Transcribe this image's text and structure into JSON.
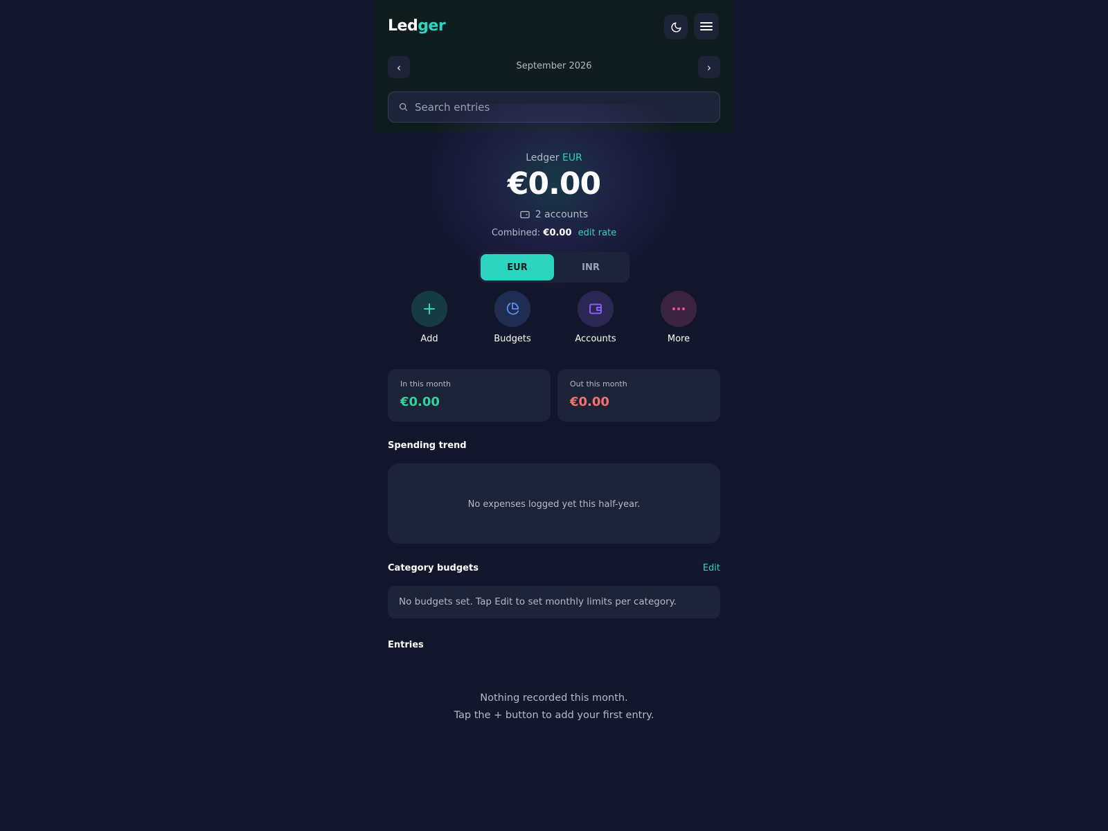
{
  "header": {
    "logo_part1": "Led",
    "logo_part2": "ger",
    "theme_icon": "moon-icon",
    "menu_icon": "hamburger-menu-icon"
  },
  "month_nav": {
    "prev": "‹",
    "label": "September 2026",
    "next": "›"
  },
  "search": {
    "placeholder": "Search entries",
    "value": "",
    "icon": "search-icon"
  },
  "hero": {
    "label": "Ledger",
    "currency": "EUR",
    "balance": "€0.00",
    "accounts_count": "2 accounts",
    "combined_label": "Combined:",
    "combined_value": "€0.00",
    "edit_rate": "edit rate"
  },
  "currency_toggle": {
    "options": [
      "EUR",
      "INR"
    ],
    "selected": "EUR"
  },
  "actions": [
    {
      "label": "Add",
      "icon": "plus-icon",
      "color": "#2dd4bf"
    },
    {
      "label": "Budgets",
      "icon": "pie-chart-icon",
      "color": "#5b8def"
    },
    {
      "label": "Accounts",
      "icon": "wallet-icon",
      "color": "#8b5cf6"
    },
    {
      "label": "More",
      "icon": "more-dots-icon",
      "color": "#ec4899"
    }
  ],
  "stats": {
    "in_label": "In this month",
    "in_value": "€0.00",
    "out_label": "Out this month",
    "out_value": "€0.00"
  },
  "spending_trend": {
    "title": "Spending trend",
    "empty": "No expenses logged yet this half-year."
  },
  "category_budgets": {
    "title": "Category budgets",
    "edit": "Edit",
    "empty": "No budgets set. Tap Edit to set monthly limits per category."
  },
  "entries": {
    "title": "Entries",
    "empty_line1": "Nothing recorded this month.",
    "empty_line2": "Tap the + button to add your first entry."
  },
  "colors": {
    "background": "#12172b",
    "accent": "#2dd4bf",
    "income": "#34d399",
    "expense": "#f87171",
    "card": "#1e2438"
  }
}
